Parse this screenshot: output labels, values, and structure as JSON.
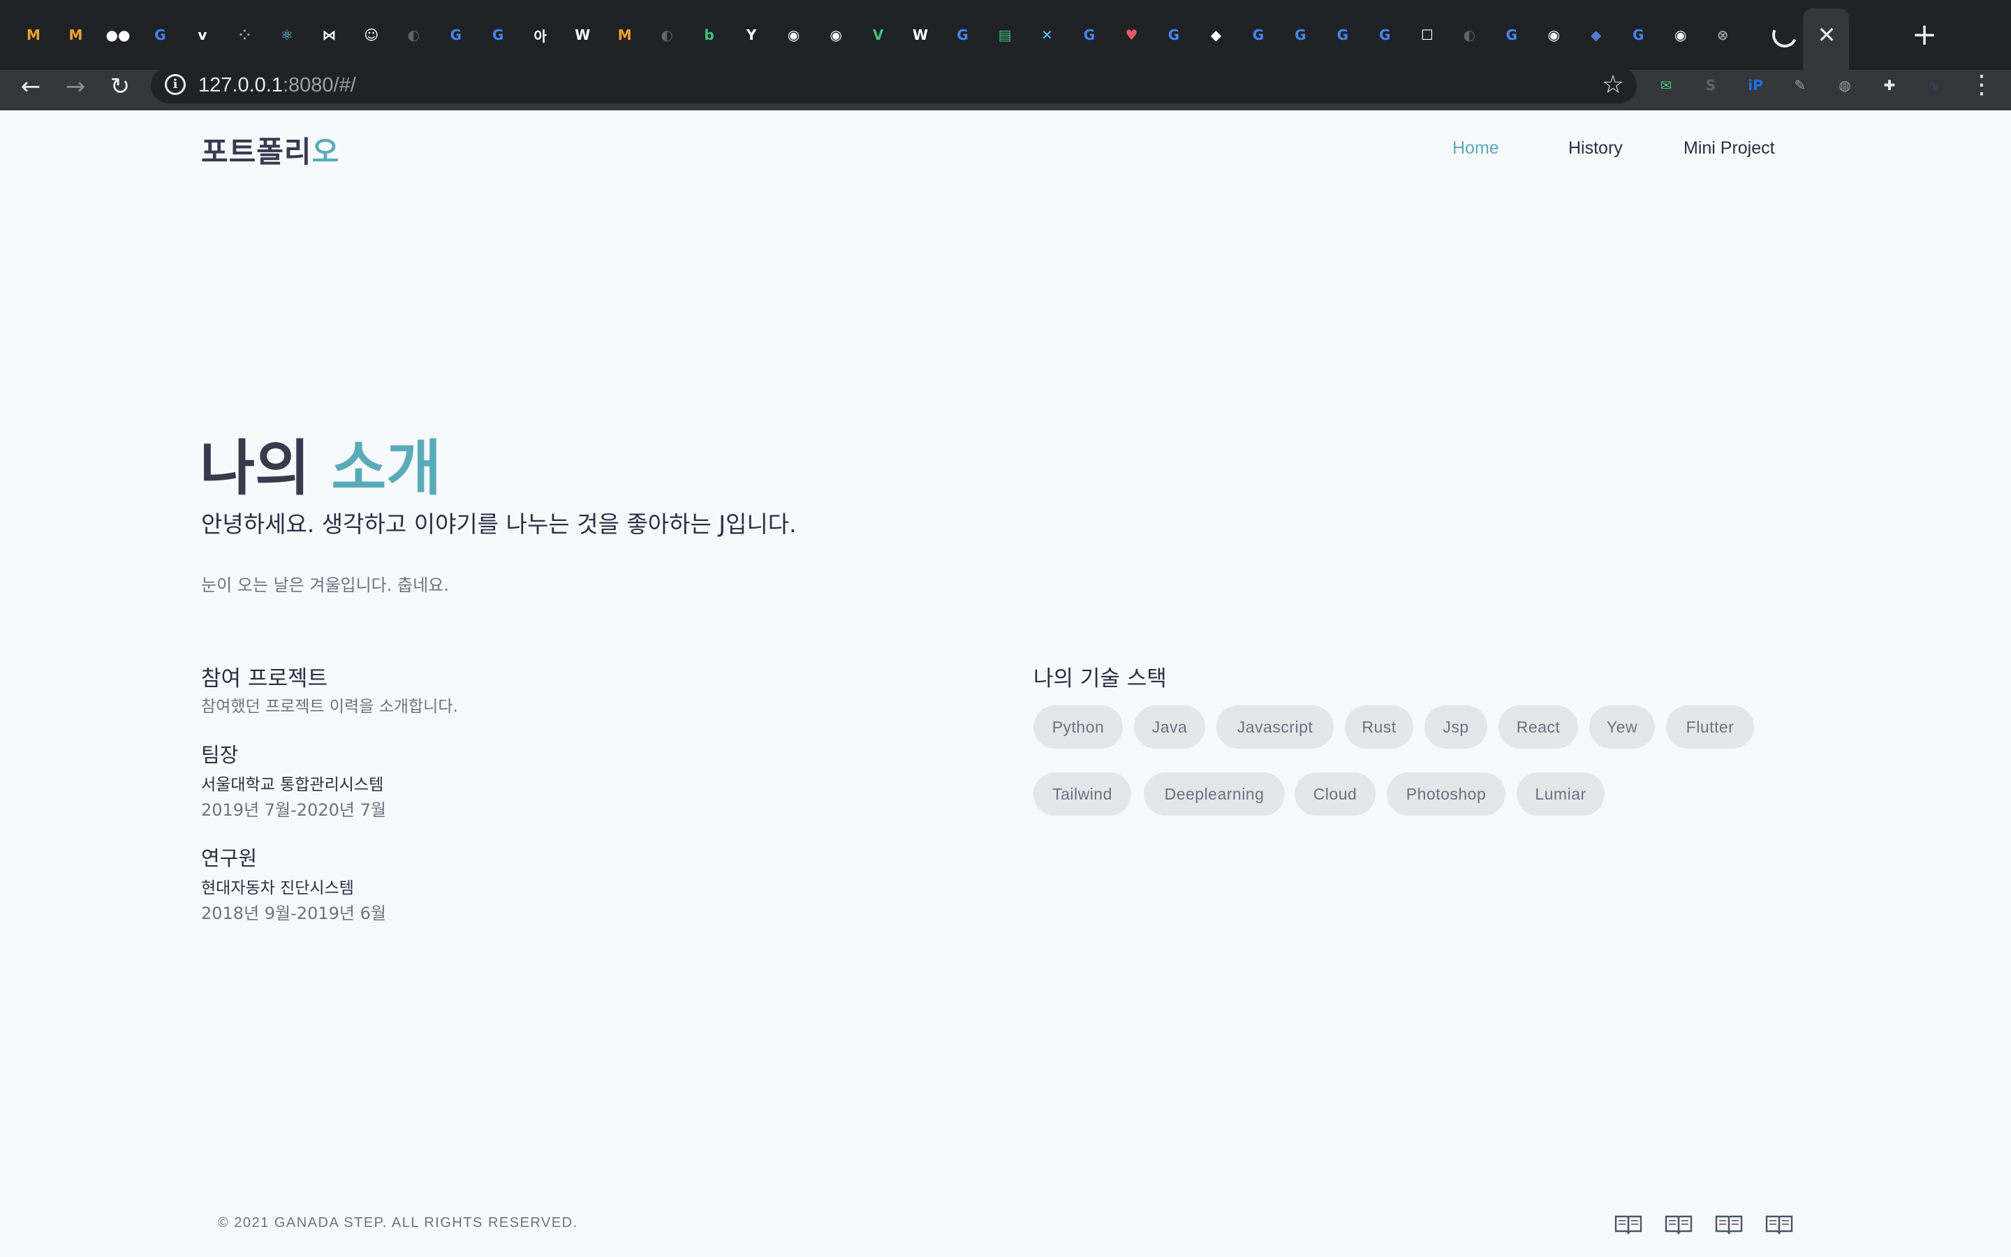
{
  "browser": {
    "url_host": "127.0.0.1",
    "url_rest": ":8080/#/",
    "tabs": [
      {
        "icon": "metro-icon",
        "glyph": "M",
        "color": "#f4a12a"
      },
      {
        "icon": "metro-icon",
        "glyph": "M",
        "color": "#f4a12a"
      },
      {
        "icon": "medium-icon",
        "glyph": "●●",
        "color": "#ffffff"
      },
      {
        "icon": "google-icon",
        "glyph": "G",
        "color": "#4285f4"
      },
      {
        "icon": "velog-icon",
        "glyph": "v",
        "color": "#ffffff"
      },
      {
        "icon": "dots-icon",
        "glyph": "⁘",
        "color": "#9aa0a6"
      },
      {
        "icon": "react-icon",
        "glyph": "⚛",
        "color": "#61dafb"
      },
      {
        "icon": "bow-icon",
        "glyph": "⋈",
        "color": "#ffffff"
      },
      {
        "icon": "avatar-icon",
        "glyph": "☺",
        "color": "#ffffff"
      },
      {
        "icon": "globe-icon",
        "glyph": "◐",
        "color": "#5f6368"
      },
      {
        "icon": "google-icon",
        "glyph": "G",
        "color": "#4285f4"
      },
      {
        "icon": "google-icon",
        "glyph": "G",
        "color": "#4285f4"
      },
      {
        "icon": "hangul-icon",
        "glyph": "아",
        "color": "#ffffff"
      },
      {
        "icon": "wikidocs-icon",
        "glyph": "W",
        "color": "#ffffff"
      },
      {
        "icon": "metro-icon",
        "glyph": "M",
        "color": "#f4a12a"
      },
      {
        "icon": "globe-icon",
        "glyph": "◐",
        "color": "#5f6368"
      },
      {
        "icon": "blog-icon",
        "glyph": "b",
        "color": "#3ec27a"
      },
      {
        "icon": "ycombinator-icon",
        "glyph": "Y",
        "color": "#ffffff"
      },
      {
        "icon": "github-icon",
        "glyph": "◉",
        "color": "#ffffff"
      },
      {
        "icon": "github-icon",
        "glyph": "◉",
        "color": "#ffffff"
      },
      {
        "icon": "vue-icon",
        "glyph": "V",
        "color": "#3ec27a"
      },
      {
        "icon": "wikidocs-icon",
        "glyph": "W",
        "color": "#ffffff"
      },
      {
        "icon": "google-icon",
        "glyph": "G",
        "color": "#4285f4"
      },
      {
        "icon": "chat-icon",
        "glyph": "▤",
        "color": "#3ec27a"
      },
      {
        "icon": "tools-icon",
        "glyph": "✕",
        "color": "#4fc3f7"
      },
      {
        "icon": "google-icon",
        "glyph": "G",
        "color": "#4285f4"
      },
      {
        "icon": "heart-icon",
        "glyph": "♥",
        "color": "#e85a6b"
      },
      {
        "icon": "google-icon",
        "glyph": "G",
        "color": "#4285f4"
      },
      {
        "icon": "bird-icon",
        "glyph": "◆",
        "color": "#ffffff"
      },
      {
        "icon": "google-icon",
        "glyph": "G",
        "color": "#4285f4"
      },
      {
        "icon": "google-icon",
        "glyph": "G",
        "color": "#4285f4"
      },
      {
        "icon": "google-icon",
        "glyph": "G",
        "color": "#4285f4"
      },
      {
        "icon": "google-icon",
        "glyph": "G",
        "color": "#4285f4"
      },
      {
        "icon": "robot-icon",
        "glyph": "☐",
        "color": "#ffffff"
      },
      {
        "icon": "globe-icon",
        "glyph": "◐",
        "color": "#5f6368"
      },
      {
        "icon": "google-icon",
        "glyph": "G",
        "color": "#4285f4"
      },
      {
        "icon": "github-icon",
        "glyph": "◉",
        "color": "#ffffff"
      },
      {
        "icon": "shield-icon",
        "glyph": "◆",
        "color": "#4a7fd6"
      },
      {
        "icon": "google-icon",
        "glyph": "G",
        "color": "#4285f4"
      },
      {
        "icon": "github-icon",
        "glyph": "◉",
        "color": "#ffffff"
      },
      {
        "icon": "x-circle-icon",
        "glyph": "⊗",
        "color": "#9aa0a6"
      }
    ],
    "extensions": [
      {
        "icon": "mail-extension-icon",
        "glyph": "✉",
        "color": "#3ec27a"
      },
      {
        "icon": "s-extension-icon",
        "glyph": "S",
        "color": "#5f6368"
      },
      {
        "icon": "ip-extension-icon",
        "glyph": "iP",
        "color": "#1a73e8"
      },
      {
        "icon": "pen-extension-icon",
        "glyph": "✎",
        "color": "#9aa0a6"
      },
      {
        "icon": "globe-extension-icon",
        "glyph": "◍",
        "color": "#9aa0a6"
      },
      {
        "icon": "puzzle-icon",
        "glyph": "✚",
        "color": "#e8eaed"
      },
      {
        "icon": "profile-avatar-icon",
        "glyph": "∿",
        "color": "#3c3a66"
      }
    ]
  },
  "header": {
    "brand_main": "포트폴리",
    "brand_accent": "오",
    "nav": [
      "Home",
      "History",
      "Mini Project"
    ]
  },
  "hero": {
    "title_main": "나의 ",
    "title_accent": "소개",
    "subtitle": "안녕하세요. 생각하고 이야기를 나누는 것을 좋아하는 J입니다.",
    "note": "눈이 오는 날은 겨울입니다. 춥네요."
  },
  "projects": {
    "title": "참여 프로젝트",
    "description": "참여했던 프로젝트 이력을 소개합니다.",
    "items": [
      {
        "role": "팀장",
        "project": "서울대학교 통합관리시스템",
        "period": "2019년 7월-2020년 7월"
      },
      {
        "role": "연구원",
        "project": "현대자동차 진단시스템",
        "period": "2018년 9월-2019년 6월"
      }
    ]
  },
  "skills": {
    "title": "나의 기술 스택",
    "chips": [
      "Python",
      "Java",
      "Javascript",
      "Rust",
      "Jsp",
      "React",
      "Yew",
      "Flutter",
      "Tailwind",
      "Deeplearning",
      "Cloud",
      "Photoshop",
      "Lumiar"
    ]
  },
  "footer": {
    "copyright": "© 2021 GANADA STEP. ALL RIGHTS RESERVED.",
    "icons": [
      "book-icon",
      "book-icon",
      "book-icon",
      "book-icon"
    ]
  },
  "colors": {
    "accent": "#5aabb8",
    "text": "#2d2d45",
    "muted": "#6b7280",
    "chip_bg": "#e5e6ea",
    "page_bg": "#f8f9fb"
  }
}
